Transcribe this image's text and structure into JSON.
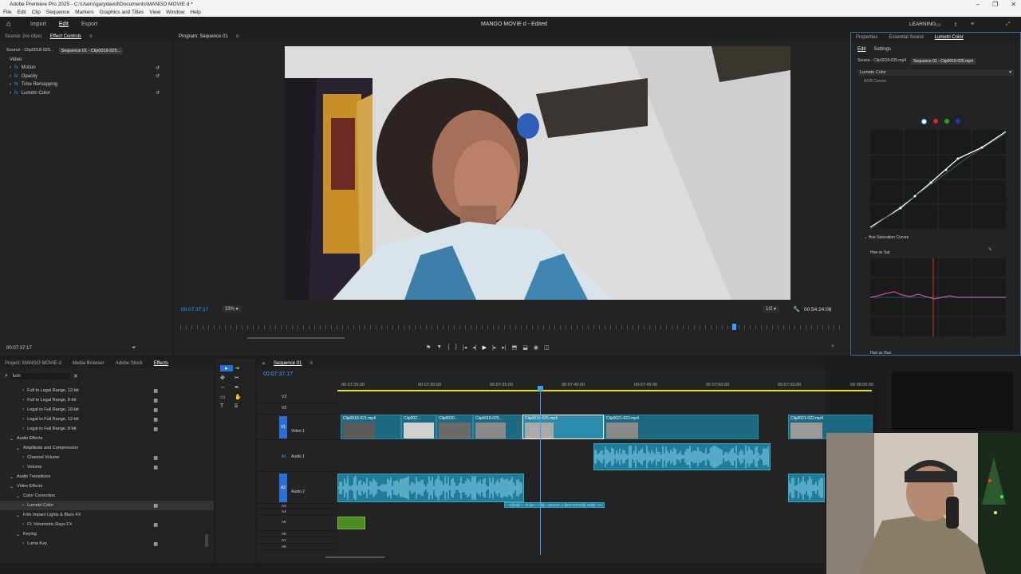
{
  "window": {
    "title": "Adobe Premiere Pro 2025 - C:\\Users\\garydavid\\Documents\\MANGO MOVIE d *",
    "menu": [
      "File",
      "Edit",
      "Clip",
      "Sequence",
      "Markers",
      "Graphics and Titles",
      "View",
      "Window",
      "Help"
    ]
  },
  "appbar": {
    "workspaces": [
      "Import",
      "Edit",
      "Export"
    ],
    "active_workspace": "Edit",
    "project_title": "MANGO MOVIE d - Edited",
    "learning": "LEARNING"
  },
  "effect_controls": {
    "tabs": [
      "Source: (no clips)",
      "Effect Controls"
    ],
    "source_clip": "Source - Clip0018-025...",
    "sequence_clip": "Sequence 01 - Clip0018-025...",
    "section": "Video",
    "effects": [
      "Motion",
      "Opacity",
      "Time Remapping",
      "Lumetri Color"
    ],
    "timecode": "00:07:37:17"
  },
  "program_monitor": {
    "title": "Program: Sequence 01",
    "timecode": "00:07:37:17",
    "zoom": "33%",
    "resolution": "1/2",
    "duration": "00:54:24:08"
  },
  "lumetri": {
    "tabs": [
      "Properties",
      "Essential Sound",
      "Lumetri Color"
    ],
    "subtabs": [
      "Edit",
      "Settings"
    ],
    "source_clip": "Source - Clip0018-025.mp4",
    "sequence_clip": "Sequence 01 - Clip0018-025.mp4",
    "effect": "Lumetri Color",
    "rgb_section": "RGB Curves",
    "hue_section": "Hue Saturation Curves",
    "hue_vs_sat": "Hue vs Sat",
    "hue_vs_hue": "Hue vs Hue"
  },
  "project_panel": {
    "tabs": [
      "Project: MANGO MOVIE d",
      "Media Browser",
      "Adobe Stock",
      "Effects"
    ],
    "active_tab": "Effects",
    "search": "lum",
    "items": [
      {
        "label": "Full to Legal Range, 12-bit",
        "indent": 3
      },
      {
        "label": "Full to Legal Range, 8-bit",
        "indent": 3
      },
      {
        "label": "Legal to Full Range, 10-bit",
        "indent": 3
      },
      {
        "label": "Legal to Full Range, 12-bit",
        "indent": 3
      },
      {
        "label": "Legal to Full Range, 8-bit",
        "indent": 3
      },
      {
        "label": "Audio Effects",
        "indent": 1
      },
      {
        "label": "Amplitude and Compression",
        "indent": 2
      },
      {
        "label": "Channel Volume",
        "indent": 3
      },
      {
        "label": "Volume",
        "indent": 3
      },
      {
        "label": "Audio Transitions",
        "indent": 1
      },
      {
        "label": "Video Effects",
        "indent": 1
      },
      {
        "label": "Color Correction",
        "indent": 2
      },
      {
        "label": "Lumetri Color",
        "indent": 3
      },
      {
        "label": "Film Impact Lights & Blurs FX",
        "indent": 2
      },
      {
        "label": "FI: Volumetric Rays FX",
        "indent": 3
      },
      {
        "label": "Keying",
        "indent": 2
      },
      {
        "label": "Luma Key",
        "indent": 3
      }
    ]
  },
  "timeline": {
    "title": "Sequence 01",
    "timecode": "00:07:37:17",
    "ruler": [
      "00:07:25:00",
      "00:07:30:00",
      "00:07:35:00",
      "00:07:40:00",
      "00:07:45:00",
      "00:07:50:00",
      "00:07:55:00",
      "00:08:00:00"
    ],
    "tracks": {
      "v3": "V3",
      "v2": "V2",
      "v1": "V1",
      "video1": "Video 1",
      "a1": "A1",
      "audio1": "Audio 1",
      "a2": "A2",
      "audio2": "Audio 2",
      "a3": "A3",
      "a4": "A4",
      "a5": "A5",
      "a6": "A6",
      "a7": "A7",
      "a8": "A8"
    },
    "video_clips": [
      "Clip0018-021.mp4",
      "Clip002...",
      "Clip0020...",
      "Clip0018-025...",
      "Clip0018-025.mp4",
      "Clip0021-022.mp4",
      "Clip0021-022.mp4"
    ]
  },
  "icons": [
    "home-icon",
    "play-icon",
    "wrench-icon",
    "fx-icon",
    "reset-icon",
    "pen-icon",
    "lock-icon",
    "eye-icon"
  ]
}
